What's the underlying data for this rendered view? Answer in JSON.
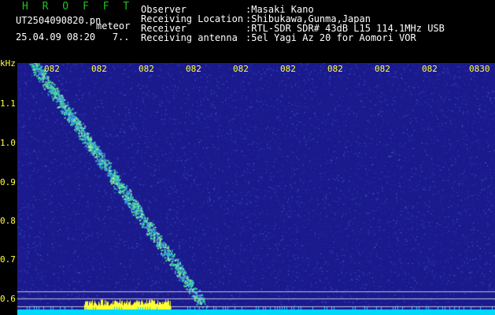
{
  "header": {
    "app_title": "H R O F F T",
    "file_name": "UT2504090820.pn",
    "meteor_label": "meteor",
    "date_time": "25.04.09 08:20   7..",
    "labels": {
      "observer": "Observer",
      "location": "Receiving Location",
      "receiver": "Receiver",
      "antenna": "Receiving antenna"
    },
    "values": {
      "observer": ":Masaki Kano",
      "location": ":Shibukawa,Gunma,Japan",
      "receiver": ":RTL-SDR SDR# 43dB L15 114.1MHz USB",
      "antenna": ":5el Yagi Az 20 for Aomori VOR"
    }
  },
  "spectrogram": {
    "y_unit": "kHz",
    "y_ticks": [
      "1.1",
      "1.0",
      "0.9",
      "0.8",
      "0.7",
      "0.6"
    ],
    "x_ticks": [
      "082",
      "082",
      "082",
      "082",
      "082",
      "082",
      "082",
      "082",
      "082",
      "0830"
    ],
    "colors": {
      "background": "#1a1a8c",
      "meteor": "#40e0a0",
      "baseline": "#00d8ff",
      "burst": "#ffff30",
      "text": "#ffff40",
      "title": "#22c022"
    }
  }
}
